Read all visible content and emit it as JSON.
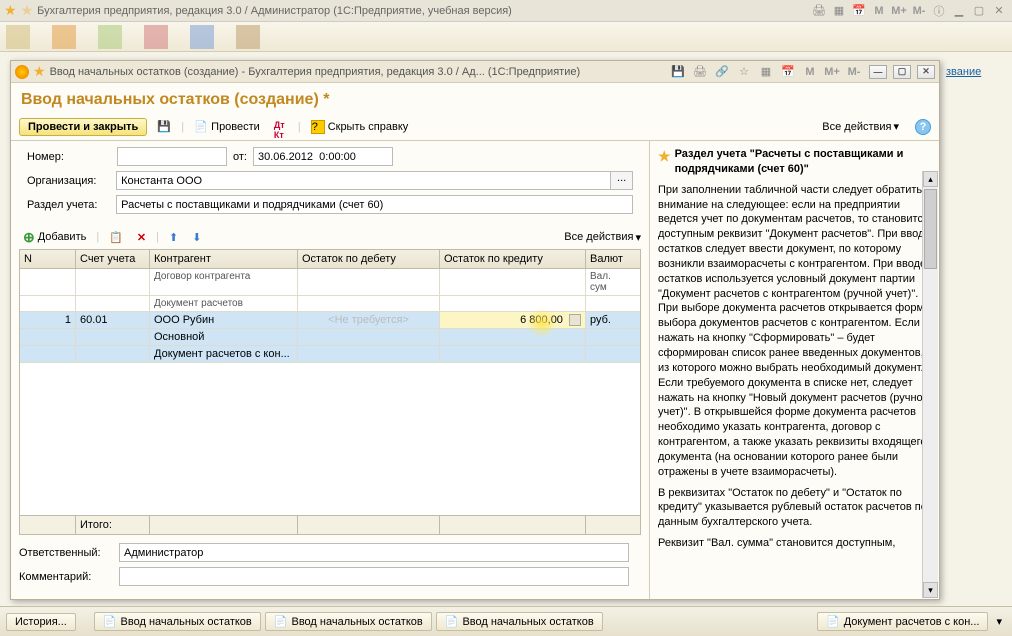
{
  "outer": {
    "title": "Бухгалтерия предприятия, редакция 3.0 / Администратор  (1С:Предприятие, учебная версия)"
  },
  "inner_window": {
    "title": "Ввод начальных остатков (создание) - Бухгалтерия предприятия, редакция 3.0 / Ад...  (1С:Предприятие)"
  },
  "doc_title": "Ввод начальных остатков (создание) *",
  "toolbar": {
    "post_and_close": "Провести и закрыть",
    "post": "Провести",
    "hide_help": "Скрыть справку",
    "all_actions": "Все действия"
  },
  "form": {
    "number_label": "Номер:",
    "number_value": "",
    "from_label": "от:",
    "date_value": "30.06.2012  0:00:00",
    "org_label": "Организация:",
    "org_value": "Константа ООО",
    "section_label": "Раздел учета:",
    "section_value": "Расчеты с поставщиками и подрядчиками (счет 60)"
  },
  "grid_toolbar": {
    "add": "Добавить",
    "all_actions": "Все действия"
  },
  "grid": {
    "headers": {
      "n": "N",
      "account": "Счет учета",
      "counterparty": "Контрагент",
      "debit": "Остаток по дебету",
      "credit": "Остаток по кредиту",
      "currency": "Валют"
    },
    "subheaders": {
      "contract": "Договор контрагента",
      "curr_sum": "Вал. сум"
    },
    "subheaders2": {
      "doc": "Документ расчетов"
    },
    "rows": [
      {
        "n": "1",
        "account": "60.01",
        "counterparty": "ООО Рубин",
        "contract": "Основной",
        "doc": "Документ расчетов с кон...",
        "debit_placeholder": "<Не требуется>",
        "credit": "6 800,00",
        "currency": "руб."
      }
    ],
    "footer_label": "Итого:"
  },
  "bottom": {
    "responsible_label": "Ответственный:",
    "responsible_value": "Администратор",
    "comment_label": "Комментарий:",
    "comment_value": ""
  },
  "help": {
    "title": "Раздел учета \"Расчеты с поставщиками и подрядчиками (счет 60)\"",
    "p1": "При заполнении табличной части следует обратить внимание на следующее: если на предприятии ведется учет по документам расчетов, то становится доступным реквизит \"Документ расчетов\". При вводе остатков следует ввести документ, по которому возникли взаиморасчеты с контрагентом. При вводе остатков используется условный документ партии \"Документ расчетов с контрагентом (ручной учет)\". При выборе документа расчетов открывается форма выбора документов расчетов с контрагентом. Если нажать на кнопку \"Сформировать\" – будет сформирован список ранее введенных документов, из которого можно выбрать необходимый документ. Если требуемого документа в списке нет, следует нажать на кнопку \"Новый документ расчетов (ручной учет)\". В открывшейся форме документа расчетов необходимо указать контрагента, договор с контрагентом, а также указать реквизиты входящего документа (на основании которого ранее были отражены в учете взаиморасчеты).",
    "p2": "В реквизитах \"Остаток по дебету\" и \"Остаток по кредиту\" указывается рублевый остаток расчетов по данным бухгалтерского учета.",
    "p3": "Реквизит \"Вал. сумма\" становится доступным,"
  },
  "taskbar": {
    "history": "История...",
    "tab1": "Ввод начальных остатков",
    "tab2": "Ввод начальных остатков",
    "tab3": "Ввод начальных остатков",
    "tab_right": "Документ расчетов с кон..."
  },
  "side": {
    "link1": "звание"
  },
  "win_controls": {
    "m": "M",
    "mp": "M+",
    "mm": "M-"
  }
}
